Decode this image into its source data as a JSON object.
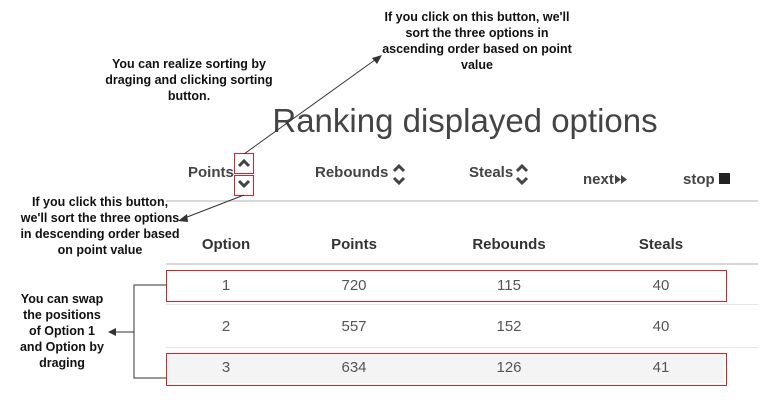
{
  "annotations": {
    "asc_note": "If you click on this button, we'll\nsort the three options in\nascending order based on point\nvalue",
    "drag_note": "You can realize sorting by\ndraging and clicking sorting\nbutton.",
    "desc_note": "If you click this button,\nwe'll sort the three options\nin descending order based\non point value",
    "swap_note": "You can swap\nthe positions\nof Option 1\nand Option by\ndraging"
  },
  "title": "Ranking displayed options",
  "controls": {
    "points_label": "Points",
    "rebounds_label": "Rebounds",
    "steals_label": "Steals",
    "next_label": "next",
    "stop_label": "stop"
  },
  "table": {
    "headers": [
      "Option",
      "Points",
      "Rebounds",
      "Steals"
    ],
    "rows": [
      [
        "1",
        "720",
        "115",
        "40"
      ],
      [
        "2",
        "557",
        "152",
        "40"
      ],
      [
        "3",
        "634",
        "126",
        "41"
      ]
    ]
  },
  "colors": {
    "highlight": "#d9232b",
    "arrow": "#333333"
  }
}
